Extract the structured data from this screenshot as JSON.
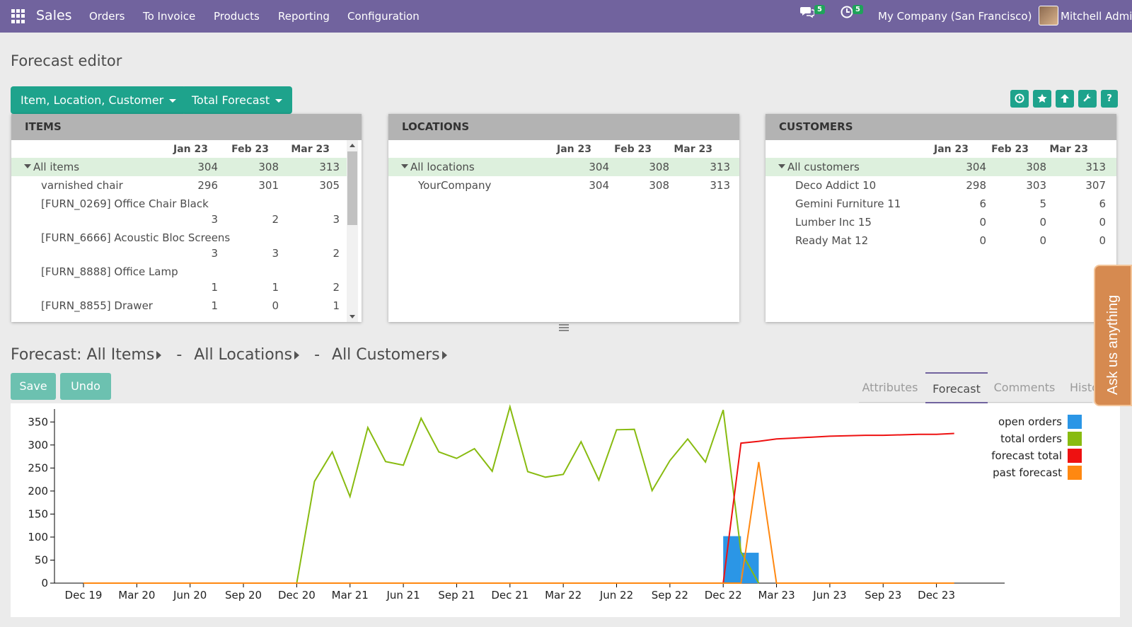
{
  "navbar": {
    "app_name": "Sales",
    "menu": [
      "Orders",
      "To Invoice",
      "Products",
      "Reporting",
      "Configuration"
    ],
    "messages_badge": "5",
    "activities_badge": "5",
    "company": "My Company (San Francisco)",
    "user": "Mitchell Admin"
  },
  "page_title": "Forecast editor",
  "toolbar": {
    "dimension_button": "Item, Location, Customer",
    "measure_button": "Total Forecast",
    "icons": [
      "clock-icon",
      "star-icon",
      "upload-icon",
      "wrench-icon",
      "help-icon"
    ]
  },
  "items_panel": {
    "title": "ITEMS",
    "columns": [
      "Jan 23",
      "Feb 23",
      "Mar 23"
    ],
    "rows": [
      {
        "label": "All items",
        "values": [
          "304",
          "308",
          "313"
        ],
        "expanded": true
      },
      {
        "label": "varnished chair",
        "values": [
          "296",
          "301",
          "305"
        ]
      },
      {
        "label": "[FURN_0269] Office Chair Black",
        "values": [
          "3",
          "2",
          "3"
        ]
      },
      {
        "label": "[FURN_6666] Acoustic Bloc Screens",
        "values": [
          "3",
          "3",
          "2"
        ]
      },
      {
        "label": "[FURN_8888] Office Lamp",
        "values": [
          "1",
          "1",
          "2"
        ]
      },
      {
        "label": "[FURN_8855] Drawer",
        "values": [
          "1",
          "0",
          "1"
        ]
      }
    ]
  },
  "locations_panel": {
    "title": "LOCATIONS",
    "columns": [
      "Jan 23",
      "Feb 23",
      "Mar 23"
    ],
    "rows": [
      {
        "label": "All locations",
        "values": [
          "304",
          "308",
          "313"
        ],
        "expanded": true
      },
      {
        "label": "YourCompany",
        "values": [
          "304",
          "308",
          "313"
        ]
      }
    ]
  },
  "customers_panel": {
    "title": "CUSTOMERS",
    "columns": [
      "Jan 23",
      "Feb 23",
      "Mar 23"
    ],
    "rows": [
      {
        "label": "All customers",
        "values": [
          "304",
          "308",
          "313"
        ],
        "expanded": true
      },
      {
        "label": "Deco Addict 10",
        "values": [
          "298",
          "303",
          "307"
        ]
      },
      {
        "label": "Gemini Furniture 11",
        "values": [
          "6",
          "5",
          "6"
        ]
      },
      {
        "label": "Lumber Inc 15",
        "values": [
          "0",
          "0",
          "0"
        ]
      },
      {
        "label": "Ready Mat 12",
        "values": [
          "0",
          "0",
          "0"
        ]
      }
    ]
  },
  "forecast_header": {
    "prefix": "Forecast:",
    "items": "All Items",
    "locations": "All Locations",
    "customers": "All Customers",
    "separator": "-"
  },
  "actions": {
    "save": "Save",
    "undo": "Undo"
  },
  "tabs": [
    "Attributes",
    "Forecast",
    "Comments",
    "Histo"
  ],
  "active_tab": "Forecast",
  "ask_widget": "Ask us anything",
  "colors": {
    "navbar": "#71639e",
    "teal": "#1ea38c",
    "open_orders": "#2b96e6",
    "total_orders": "#88bb10",
    "forecast_total": "#ee1111",
    "past_forecast": "#ff8811"
  },
  "chart_data": {
    "type": "line",
    "x": [
      "Dec 19",
      "Jan 20",
      "Feb 20",
      "Mar 20",
      "Apr 20",
      "May 20",
      "Jun 20",
      "Jul 20",
      "Aug 20",
      "Sep 20",
      "Oct 20",
      "Nov 20",
      "Dec 20",
      "Jan 21",
      "Feb 21",
      "Mar 21",
      "Apr 21",
      "May 21",
      "Jun 21",
      "Jul 21",
      "Aug 21",
      "Sep 21",
      "Oct 21",
      "Nov 21",
      "Dec 21",
      "Jan 22",
      "Feb 22",
      "Mar 22",
      "Apr 22",
      "May 22",
      "Jun 22",
      "Jul 22",
      "Aug 22",
      "Sep 22",
      "Oct 22",
      "Nov 22",
      "Dec 22",
      "Jan 23",
      "Feb 23",
      "Mar 23",
      "Apr 23",
      "May 23",
      "Jun 23",
      "Jul 23",
      "Aug 23",
      "Sep 23",
      "Oct 23",
      "Nov 23",
      "Dec 23",
      "Jan 24"
    ],
    "x_tick_labels": [
      "Dec 19",
      "Mar 20",
      "Jun 20",
      "Sep 20",
      "Dec 20",
      "Mar 21",
      "Jun 21",
      "Sep 21",
      "Dec 21",
      "Mar 22",
      "Jun 22",
      "Sep 22",
      "Dec 22",
      "Mar 23",
      "Jun 23",
      "Sep 23",
      "Dec 23"
    ],
    "ylim": [
      0,
      375
    ],
    "y_ticks": [
      0,
      50,
      100,
      150,
      200,
      250,
      300,
      350
    ],
    "legend_position": "top-right",
    "series": [
      {
        "name": "open orders",
        "kind": "bar",
        "x": [
          "Dec 22",
          "Jan 23"
        ],
        "values": [
          102,
          66
        ]
      },
      {
        "name": "total orders",
        "kind": "line",
        "values": [
          0,
          0,
          0,
          0,
          0,
          0,
          0,
          0,
          0,
          0,
          0,
          0,
          0,
          221,
          285,
          188,
          338,
          264,
          256,
          358,
          285,
          271,
          292,
          243,
          383,
          242,
          230,
          236,
          307,
          224,
          333,
          334,
          201,
          266,
          313,
          263,
          376,
          68,
          0,
          null,
          null,
          null,
          null,
          null,
          null,
          null,
          null,
          null,
          null,
          null
        ]
      },
      {
        "name": "forecast total",
        "kind": "line",
        "values": [
          0,
          0,
          0,
          0,
          0,
          0,
          0,
          0,
          0,
          0,
          0,
          0,
          0,
          0,
          0,
          0,
          0,
          0,
          0,
          0,
          0,
          0,
          0,
          0,
          0,
          0,
          0,
          0,
          0,
          0,
          0,
          0,
          0,
          0,
          0,
          0,
          0,
          304,
          308,
          313,
          315,
          317,
          319,
          320,
          321,
          321,
          322,
          323,
          323,
          325
        ]
      },
      {
        "name": "past forecast",
        "kind": "line",
        "values": [
          0,
          0,
          0,
          0,
          0,
          0,
          0,
          0,
          0,
          0,
          0,
          0,
          0,
          0,
          0,
          0,
          0,
          0,
          0,
          0,
          0,
          0,
          0,
          0,
          0,
          0,
          0,
          0,
          0,
          0,
          0,
          0,
          0,
          0,
          0,
          0,
          0,
          0,
          263,
          0,
          0,
          0,
          0,
          0,
          0,
          0,
          0,
          0,
          0,
          0
        ]
      }
    ]
  }
}
